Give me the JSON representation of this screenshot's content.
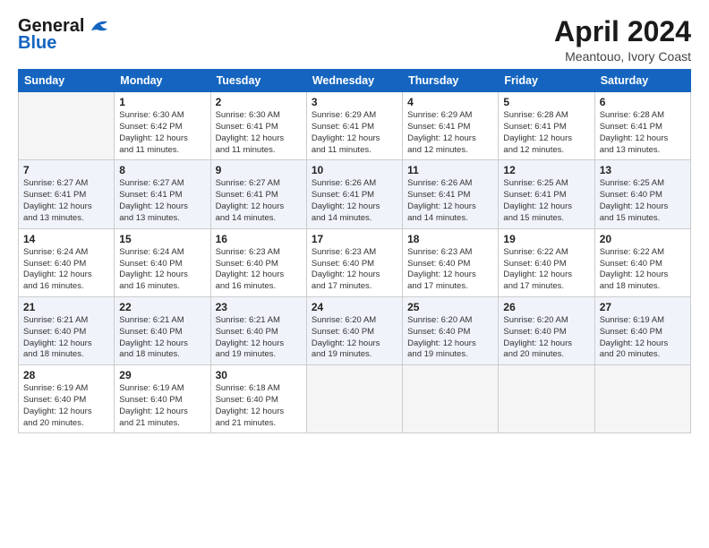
{
  "logo": {
    "line1": "General",
    "line2": "Blue"
  },
  "title": "April 2024",
  "subtitle": "Meantouo, Ivory Coast",
  "days_header": [
    "Sunday",
    "Monday",
    "Tuesday",
    "Wednesday",
    "Thursday",
    "Friday",
    "Saturday"
  ],
  "weeks": [
    [
      {
        "num": "",
        "empty": true
      },
      {
        "num": "1",
        "sunrise": "6:30 AM",
        "sunset": "6:42 PM",
        "daylight": "12 hours and 11 minutes."
      },
      {
        "num": "2",
        "sunrise": "6:30 AM",
        "sunset": "6:41 PM",
        "daylight": "12 hours and 11 minutes."
      },
      {
        "num": "3",
        "sunrise": "6:29 AM",
        "sunset": "6:41 PM",
        "daylight": "12 hours and 11 minutes."
      },
      {
        "num": "4",
        "sunrise": "6:29 AM",
        "sunset": "6:41 PM",
        "daylight": "12 hours and 12 minutes."
      },
      {
        "num": "5",
        "sunrise": "6:28 AM",
        "sunset": "6:41 PM",
        "daylight": "12 hours and 12 minutes."
      },
      {
        "num": "6",
        "sunrise": "6:28 AM",
        "sunset": "6:41 PM",
        "daylight": "12 hours and 13 minutes."
      }
    ],
    [
      {
        "num": "7",
        "sunrise": "6:27 AM",
        "sunset": "6:41 PM",
        "daylight": "12 hours and 13 minutes."
      },
      {
        "num": "8",
        "sunrise": "6:27 AM",
        "sunset": "6:41 PM",
        "daylight": "12 hours and 13 minutes."
      },
      {
        "num": "9",
        "sunrise": "6:27 AM",
        "sunset": "6:41 PM",
        "daylight": "12 hours and 14 minutes."
      },
      {
        "num": "10",
        "sunrise": "6:26 AM",
        "sunset": "6:41 PM",
        "daylight": "12 hours and 14 minutes."
      },
      {
        "num": "11",
        "sunrise": "6:26 AM",
        "sunset": "6:41 PM",
        "daylight": "12 hours and 14 minutes."
      },
      {
        "num": "12",
        "sunrise": "6:25 AM",
        "sunset": "6:41 PM",
        "daylight": "12 hours and 15 minutes."
      },
      {
        "num": "13",
        "sunrise": "6:25 AM",
        "sunset": "6:40 PM",
        "daylight": "12 hours and 15 minutes."
      }
    ],
    [
      {
        "num": "14",
        "sunrise": "6:24 AM",
        "sunset": "6:40 PM",
        "daylight": "12 hours and 16 minutes."
      },
      {
        "num": "15",
        "sunrise": "6:24 AM",
        "sunset": "6:40 PM",
        "daylight": "12 hours and 16 minutes."
      },
      {
        "num": "16",
        "sunrise": "6:23 AM",
        "sunset": "6:40 PM",
        "daylight": "12 hours and 16 minutes."
      },
      {
        "num": "17",
        "sunrise": "6:23 AM",
        "sunset": "6:40 PM",
        "daylight": "12 hours and 17 minutes."
      },
      {
        "num": "18",
        "sunrise": "6:23 AM",
        "sunset": "6:40 PM",
        "daylight": "12 hours and 17 minutes."
      },
      {
        "num": "19",
        "sunrise": "6:22 AM",
        "sunset": "6:40 PM",
        "daylight": "12 hours and 17 minutes."
      },
      {
        "num": "20",
        "sunrise": "6:22 AM",
        "sunset": "6:40 PM",
        "daylight": "12 hours and 18 minutes."
      }
    ],
    [
      {
        "num": "21",
        "sunrise": "6:21 AM",
        "sunset": "6:40 PM",
        "daylight": "12 hours and 18 minutes."
      },
      {
        "num": "22",
        "sunrise": "6:21 AM",
        "sunset": "6:40 PM",
        "daylight": "12 hours and 18 minutes."
      },
      {
        "num": "23",
        "sunrise": "6:21 AM",
        "sunset": "6:40 PM",
        "daylight": "12 hours and 19 minutes."
      },
      {
        "num": "24",
        "sunrise": "6:20 AM",
        "sunset": "6:40 PM",
        "daylight": "12 hours and 19 minutes."
      },
      {
        "num": "25",
        "sunrise": "6:20 AM",
        "sunset": "6:40 PM",
        "daylight": "12 hours and 19 minutes."
      },
      {
        "num": "26",
        "sunrise": "6:20 AM",
        "sunset": "6:40 PM",
        "daylight": "12 hours and 20 minutes."
      },
      {
        "num": "27",
        "sunrise": "6:19 AM",
        "sunset": "6:40 PM",
        "daylight": "12 hours and 20 minutes."
      }
    ],
    [
      {
        "num": "28",
        "sunrise": "6:19 AM",
        "sunset": "6:40 PM",
        "daylight": "12 hours and 20 minutes."
      },
      {
        "num": "29",
        "sunrise": "6:19 AM",
        "sunset": "6:40 PM",
        "daylight": "12 hours and 21 minutes."
      },
      {
        "num": "30",
        "sunrise": "6:18 AM",
        "sunset": "6:40 PM",
        "daylight": "12 hours and 21 minutes."
      },
      {
        "num": "",
        "empty": true
      },
      {
        "num": "",
        "empty": true
      },
      {
        "num": "",
        "empty": true
      },
      {
        "num": "",
        "empty": true
      }
    ]
  ],
  "labels": {
    "sunrise": "Sunrise:",
    "sunset": "Sunset:",
    "daylight": "Daylight:"
  }
}
